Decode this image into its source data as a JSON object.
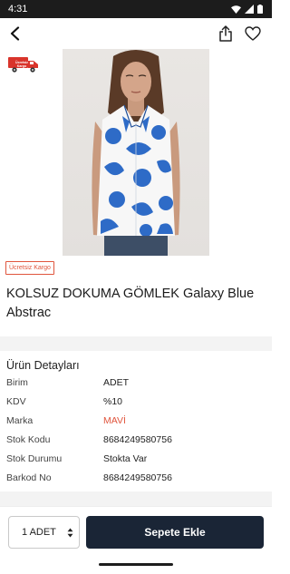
{
  "status_bar": {
    "time": "4:31"
  },
  "cargo_badge": {
    "label_line1": "Ücretsiz",
    "label_line2": "Kargo"
  },
  "product": {
    "free_shipping_tag": "Ücretsiz Kargo",
    "title": "KOLSUZ DOKUMA GÖMLEK Galaxy Blue Abstrac"
  },
  "details": {
    "heading": "Ürün Detayları",
    "rows": [
      {
        "label": "Birim",
        "value": "ADET"
      },
      {
        "label": "KDV",
        "value": "%10"
      },
      {
        "label": "Marka",
        "value": "MAVİ"
      },
      {
        "label": "Stok Kodu",
        "value": "8684249580756"
      },
      {
        "label": "Stok Durumu",
        "value": "Stokta Var"
      },
      {
        "label": "Barkod No",
        "value": "8684249580756"
      }
    ]
  },
  "bottom_bar": {
    "quantity": "1 ADET",
    "add_to_cart_label": "Sepete Ekle"
  },
  "icons": {
    "back": "back-arrow-icon",
    "share": "share-icon",
    "favorite": "heart-icon",
    "cargo": "delivery-truck-icon"
  },
  "colors": {
    "accent": "#e0553d",
    "button_dark": "#1a2536",
    "status_bar": "#1c1c1c",
    "shirt_blue": "#2e6bc7"
  }
}
